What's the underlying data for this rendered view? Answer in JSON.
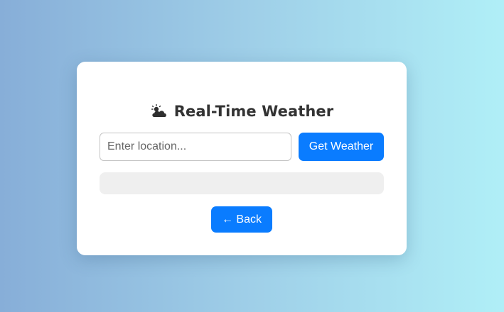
{
  "app": {
    "icon": "sun-behind-cloud-icon",
    "title": "Real-Time Weather"
  },
  "search": {
    "placeholder": "Enter location...",
    "value": ""
  },
  "actions": {
    "get_weather_label": "Get Weather",
    "back_label": "← Back"
  },
  "result": {
    "text": ""
  },
  "colors": {
    "accent": "#0a7cff",
    "card": "#ffffff",
    "result_bg": "#efefef",
    "title": "#333333"
  }
}
